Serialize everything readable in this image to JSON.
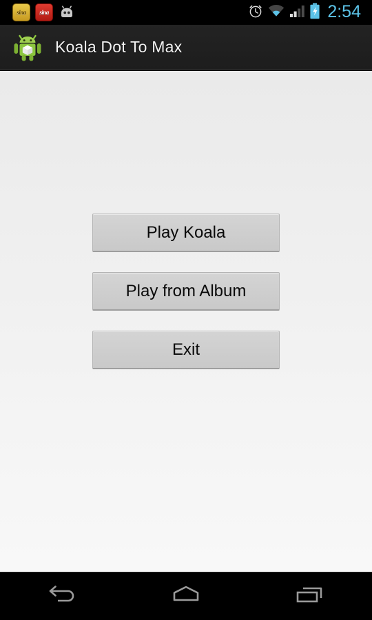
{
  "status_bar": {
    "notifications": [
      {
        "name": "sina-weibo-notification-icon",
        "label": "sina",
        "style": "gold"
      },
      {
        "name": "sina-news-notification-icon",
        "label": "sina",
        "style": "red"
      },
      {
        "name": "android-system-notification-icon",
        "label": "",
        "style": "droid"
      }
    ],
    "alarm_icon": "alarm-clock-icon",
    "wifi_icon": "wifi-icon",
    "signal_icon": "cellular-signal-icon",
    "battery_icon": "battery-charging-icon",
    "time": "2:54",
    "time_color": "#5cc3e8"
  },
  "action_bar": {
    "app_icon": "android-robot-app-icon",
    "title": "Koala Dot To Max",
    "title_color": "#f2f2f2",
    "background_color": "#212121"
  },
  "main": {
    "background_color": "#efefef",
    "buttons": [
      {
        "name": "play-koala-button",
        "label": "Play Koala"
      },
      {
        "name": "play-from-album-button",
        "label": "Play from Album"
      },
      {
        "name": "exit-button",
        "label": "Exit"
      }
    ],
    "button_fill": "#d0d0d0",
    "button_text_color": "#0a0a0a"
  },
  "nav_bar": {
    "background_color": "#000000",
    "icon_color": "#9a9a9a",
    "buttons": [
      {
        "name": "nav-back-button",
        "icon": "back-arrow-icon"
      },
      {
        "name": "nav-home-button",
        "icon": "home-icon"
      },
      {
        "name": "nav-recents-button",
        "icon": "recent-apps-icon"
      }
    ]
  }
}
